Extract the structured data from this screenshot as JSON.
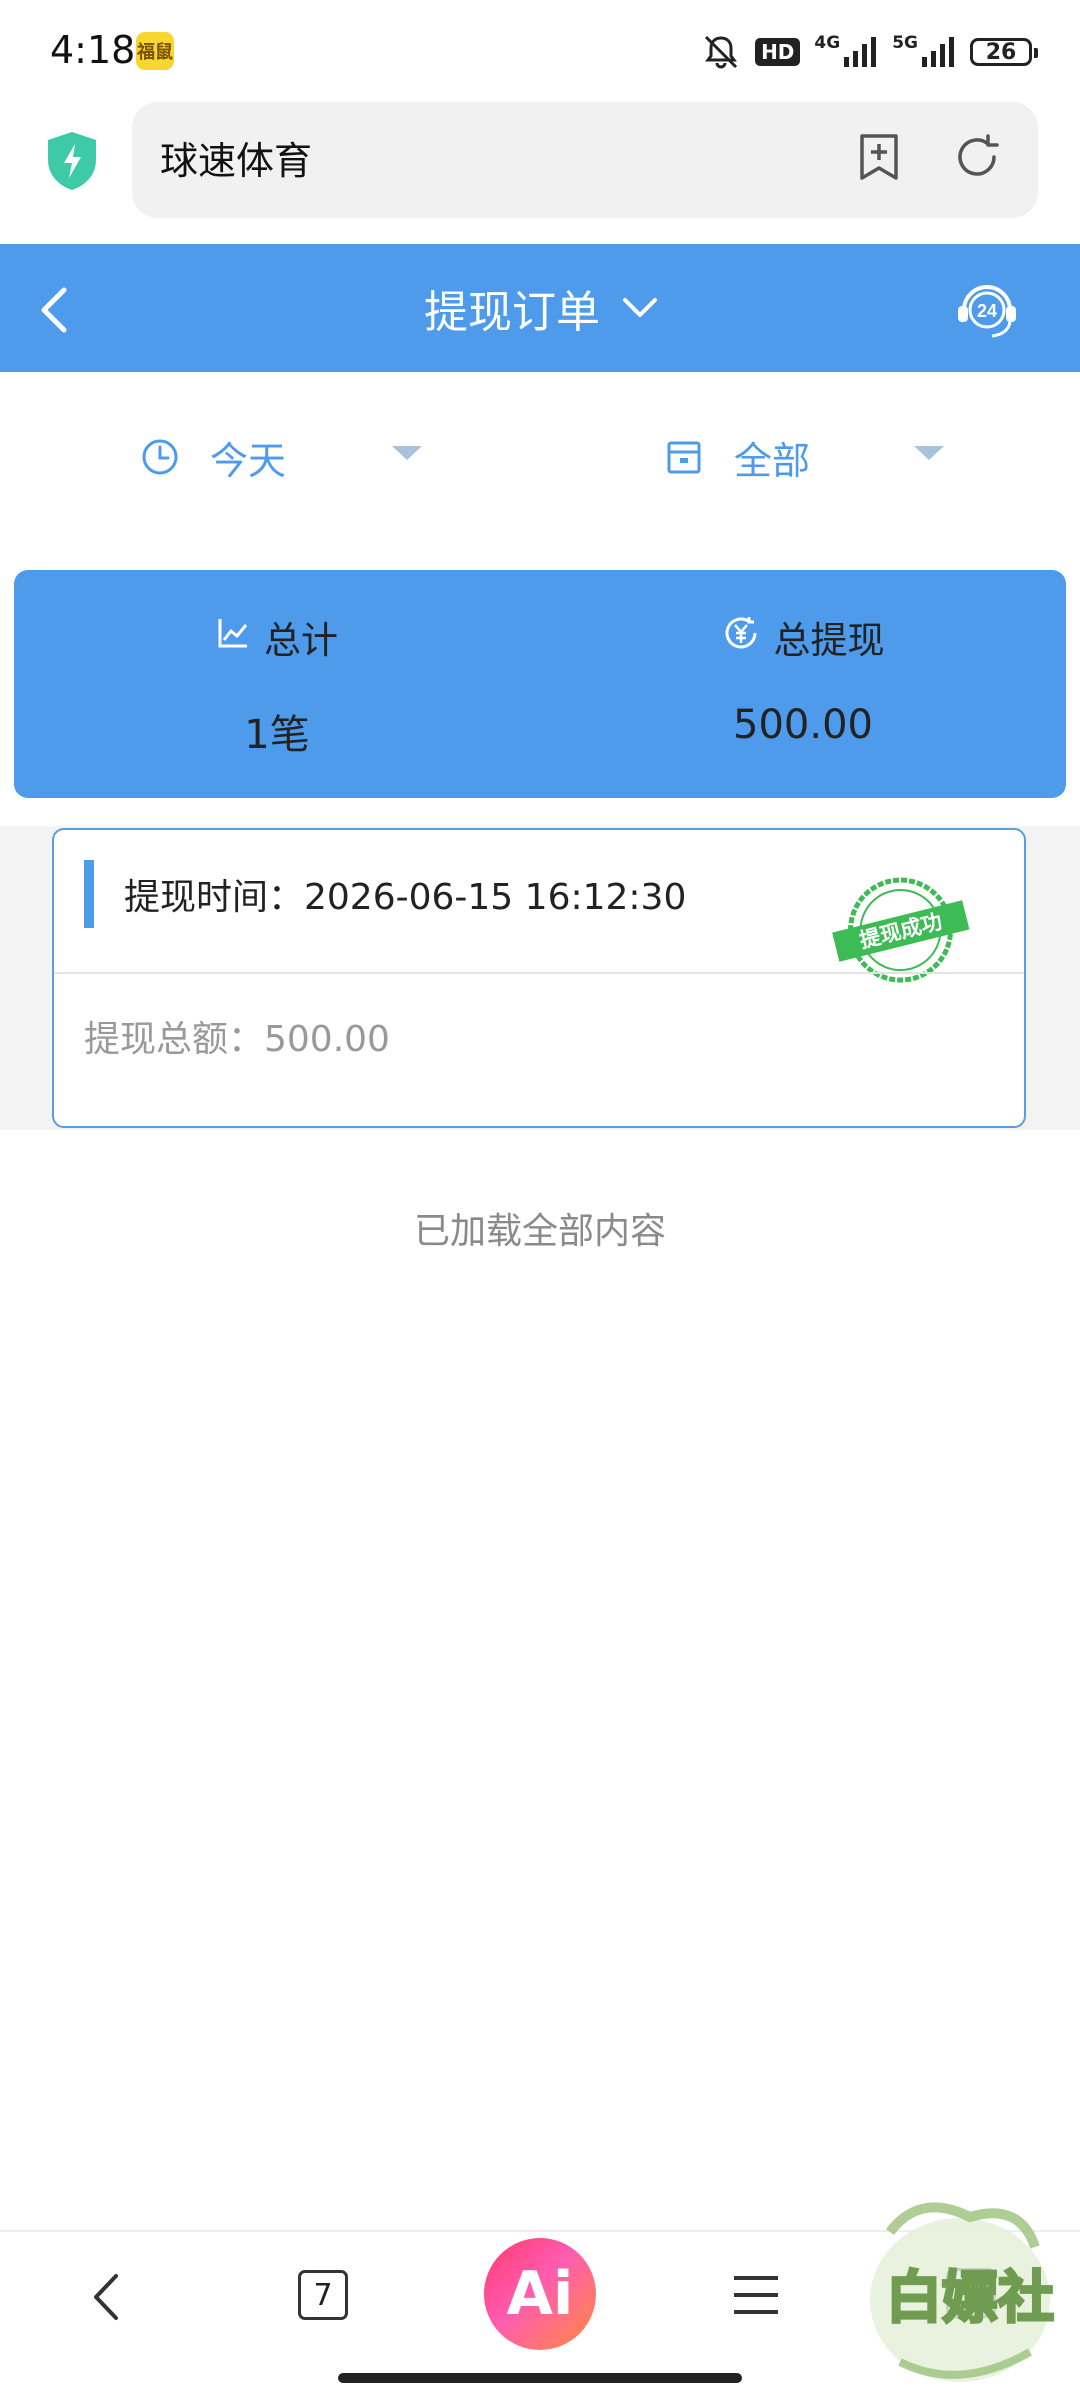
{
  "status_bar": {
    "time": "4:18",
    "app_badge_text": "福鼠",
    "hd_label": "HD",
    "net1_label": "4G",
    "net2_label": "5G",
    "battery": "26"
  },
  "browser": {
    "url_title": "球速体育"
  },
  "header": {
    "title": "提现订单",
    "support_label": "24",
    "color": "#4e9beb"
  },
  "filters": {
    "date": "今天",
    "type": "全部"
  },
  "summary": {
    "total_label": "总计",
    "total_value": "1笔",
    "withdraw_label": "总提现",
    "withdraw_value": "500.00"
  },
  "records": [
    {
      "time": "提现时间：2026-06-15 16:12:30",
      "amount": "提现总额：500.00",
      "stamp": "提现成功"
    }
  ],
  "list_footer": "已加载全部内容",
  "bottom_nav": {
    "tab_count": "7",
    "ai_label": "Ai"
  },
  "watermark": "白嫖社"
}
